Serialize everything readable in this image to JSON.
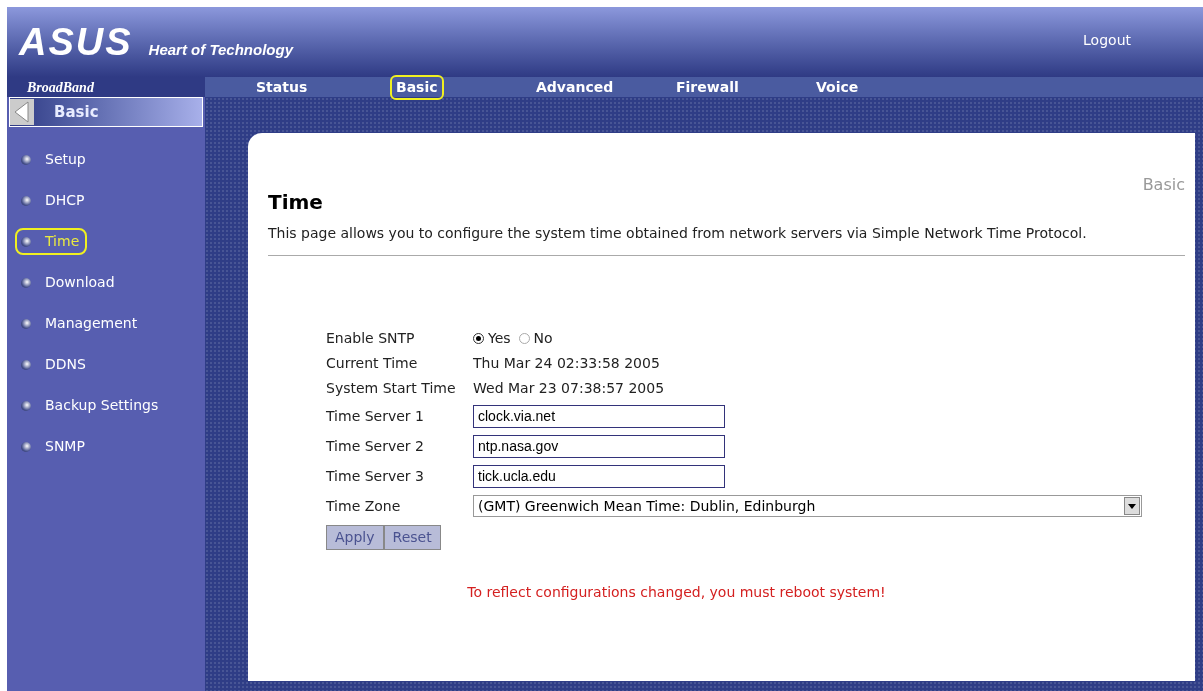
{
  "header": {
    "logo": "ASUS",
    "tagline": "Heart of Technology",
    "logout": "Logout"
  },
  "nav": {
    "brand": "BroadBand",
    "tabs": [
      {
        "label": "Status",
        "selected": false
      },
      {
        "label": "Basic",
        "selected": true
      },
      {
        "label": "Advanced",
        "selected": false
      },
      {
        "label": "Firewall",
        "selected": false
      },
      {
        "label": "Voice",
        "selected": false
      }
    ]
  },
  "sidebar": {
    "section": "Basic",
    "items": [
      {
        "label": "Setup",
        "selected": false
      },
      {
        "label": "DHCP",
        "selected": false
      },
      {
        "label": "Time",
        "selected": true
      },
      {
        "label": "Download",
        "selected": false
      },
      {
        "label": "Management",
        "selected": false
      },
      {
        "label": "DDNS",
        "selected": false
      },
      {
        "label": "Backup Settings",
        "selected": false
      },
      {
        "label": "SNMP",
        "selected": false
      }
    ]
  },
  "page": {
    "title": "Time",
    "section": "Basic",
    "description": "This page allows you to configure the system time obtained from network servers via Simple Network Time Protocol.",
    "form": [
      {
        "kind": "radio",
        "label": "Enable SNTP",
        "options": [
          {
            "label": "Yes",
            "selected": true
          },
          {
            "label": "No",
            "selected": false
          }
        ]
      },
      {
        "kind": "text",
        "label": "Current Time",
        "value": "Thu Mar 24 02:33:58 2005"
      },
      {
        "kind": "text",
        "label": "System Start Time",
        "value": "Wed Mar 23 07:38:57 2005"
      },
      {
        "kind": "input",
        "label": "Time Server 1",
        "value": "clock.via.net"
      },
      {
        "kind": "input",
        "label": "Time Server 2",
        "value": "ntp.nasa.gov"
      },
      {
        "kind": "input",
        "label": "Time Server 3",
        "value": "tick.ucla.edu"
      },
      {
        "kind": "select",
        "label": "Time Zone",
        "value": "(GMT) Greenwich Mean Time: Dublin, Edinburgh"
      }
    ],
    "buttons": [
      "Apply",
      "Reset"
    ],
    "notice": "To reflect configurations changed, you must reboot system!"
  }
}
